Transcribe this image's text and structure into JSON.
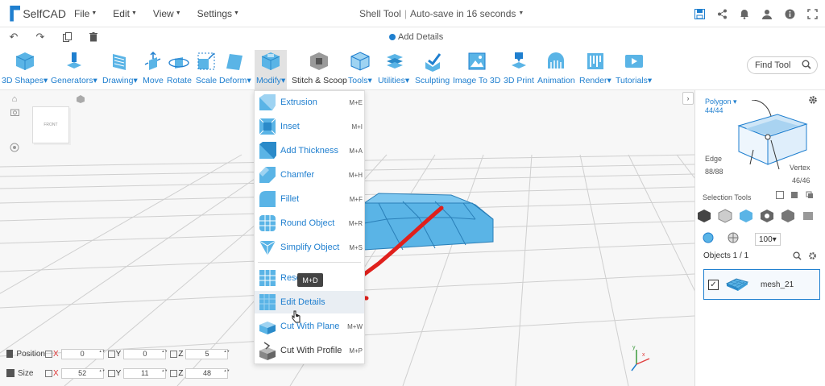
{
  "app": {
    "logo_text": "SelfCAD",
    "menu": [
      "File",
      "Edit",
      "View",
      "Settings"
    ],
    "title": "Shell Tool",
    "autosave": "Auto-save in 16 seconds",
    "hint": "Add Details"
  },
  "toolbar": {
    "tools": [
      {
        "label": "3D Shapes",
        "caret": true
      },
      {
        "label": "Generators",
        "caret": true
      },
      {
        "label": "Drawing",
        "caret": true
      },
      {
        "label": "Move",
        "caret": false
      },
      {
        "label": "Rotate",
        "caret": false
      },
      {
        "label": "Scale",
        "caret": false
      },
      {
        "label": "Deform",
        "caret": true
      },
      {
        "label": "Modify",
        "caret": true
      },
      {
        "label": "Stitch & Scoop",
        "caret": false
      },
      {
        "label": "Tools",
        "caret": true
      },
      {
        "label": "Utilities",
        "caret": true
      },
      {
        "label": "Sculpting",
        "caret": false
      },
      {
        "label": "Image To 3D",
        "caret": false
      },
      {
        "label": "3D Print",
        "caret": false
      },
      {
        "label": "Animation",
        "caret": false
      },
      {
        "label": "Render",
        "caret": true
      },
      {
        "label": "Tutorials",
        "caret": true
      }
    ],
    "find_tool": "Find Tool"
  },
  "modify_menu": {
    "items": [
      {
        "label": "Extrusion",
        "shortcut": "M+E"
      },
      {
        "label": "Inset",
        "shortcut": "M+I"
      },
      {
        "label": "Add Thickness",
        "shortcut": "M+A"
      },
      {
        "label": "Chamfer",
        "shortcut": "M+H"
      },
      {
        "label": "Fillet",
        "shortcut": "M+F"
      },
      {
        "label": "Round Object",
        "shortcut": "M+R"
      },
      {
        "label": "Simplify Object",
        "shortcut": "M+S"
      },
      {
        "label": "Reso",
        "shortcut": ""
      },
      {
        "label": "Edit Details",
        "shortcut": ""
      },
      {
        "label": "Cut With Plane",
        "shortcut": "M+W"
      },
      {
        "label": "Cut With Profile",
        "shortcut": "M+P"
      }
    ],
    "tooltip": "M+D"
  },
  "viewport": {
    "nav_cube_label": "FRONT"
  },
  "right_panel": {
    "polygon_label": "Polygon",
    "polygon_count": "44/44",
    "edge_label": "Edge",
    "edge_count": "88/88",
    "vertex_label": "Vertex",
    "vertex_count": "46/46",
    "selection_tools": "Selection Tools",
    "brush_size": "100",
    "objects_header": "Objects 1 / 1",
    "object_name": "mesh_21"
  },
  "transform": {
    "position_label": "Position",
    "size_label": "Size",
    "position": {
      "x": "0",
      "y": "0",
      "z": "5"
    },
    "size": {
      "x": "52",
      "y": "11",
      "z": "48"
    }
  },
  "colors": {
    "accent": "#1f7fcf",
    "mesh": "#5ab4e6",
    "annotation": "#e0201c"
  }
}
